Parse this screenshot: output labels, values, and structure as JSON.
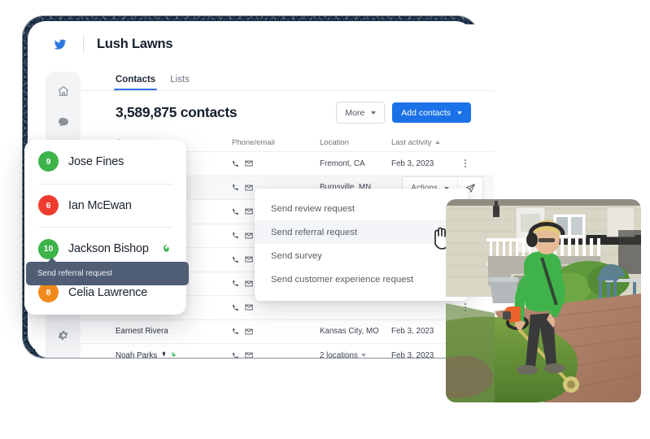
{
  "app": {
    "title": "Lush Lawns",
    "logo_icon": "bird-logo-icon"
  },
  "sidebar": {
    "items": [
      {
        "name": "home",
        "icon": "home-icon"
      },
      {
        "name": "messages",
        "icon": "chat-bubble-icon"
      },
      {
        "name": "locations",
        "icon": "map-pin-icon"
      }
    ],
    "bottom": {
      "name": "settings",
      "icon": "gear-icon"
    }
  },
  "tabs": [
    {
      "label": "Contacts",
      "active": true
    },
    {
      "label": "Lists",
      "active": false
    }
  ],
  "toolbar": {
    "count_label": "3,589,875 contacts",
    "more_label": "More",
    "add_contacts_label": "Add contacts"
  },
  "table": {
    "headers": {
      "contact_name": "Contact name",
      "phone_email": "Phone/email",
      "location": "Location",
      "last_activity": "Last activity"
    },
    "sort": {
      "column": "Last activity",
      "direction": "asc"
    },
    "rows": [
      {
        "name": "",
        "location": "Fremont, CA",
        "last_activity": "Feb 3, 2023",
        "alt": false
      },
      {
        "name": "",
        "location": "Burnsville, MN",
        "last_activity": "",
        "alt": true
      },
      {
        "name": "",
        "location": "",
        "last_activity": "",
        "alt": false
      },
      {
        "name": "",
        "location": "",
        "last_activity": "",
        "alt": false
      },
      {
        "name": "",
        "location": "",
        "last_activity": "",
        "alt": false
      },
      {
        "name": "",
        "location": "",
        "last_activity": "",
        "alt": false
      },
      {
        "name": "",
        "location": "",
        "last_activity": "",
        "alt": false
      },
      {
        "name": "Earnest Rivera",
        "location": "Kansas City, MO",
        "last_activity": "Feb 3, 2023",
        "alt": false
      },
      {
        "name": "Noah Parks",
        "location": "2 locations",
        "last_activity": "Feb 3, 2023",
        "alt": false
      }
    ]
  },
  "action_bar": {
    "actions_label": "Actions",
    "send_icon": "paper-plane-icon"
  },
  "dropdown_menu": {
    "items": [
      {
        "label": "Send review request",
        "highlighted": false
      },
      {
        "label": "Send referral request",
        "highlighted": true
      },
      {
        "label": "Send survey",
        "highlighted": false
      },
      {
        "label": "Send customer experience request",
        "highlighted": false
      }
    ]
  },
  "contacts_card": {
    "items": [
      {
        "score": "9",
        "name": "Jose Fines",
        "color": "#3cb44a",
        "flame": false
      },
      {
        "score": "6",
        "name": "Ian McEwan",
        "color": "#ee3b2e",
        "flame": false
      },
      {
        "score": "10",
        "name": "Jackson Bishop",
        "color": "#3cb44a",
        "flame": true
      },
      {
        "score": "8",
        "name": "Celia Lawrence",
        "color": "#f08a1c",
        "flame": false
      }
    ]
  },
  "tooltip": {
    "text": "Send referral request"
  },
  "photo": {
    "alt": "Landscaper in green shirt using a string trimmer on a front lawn"
  },
  "colors": {
    "primary": "#1b72e8",
    "tab_underline": "#2f6fe4",
    "tooltip_bg": "#4f5d75",
    "halo": "#0d2240"
  }
}
